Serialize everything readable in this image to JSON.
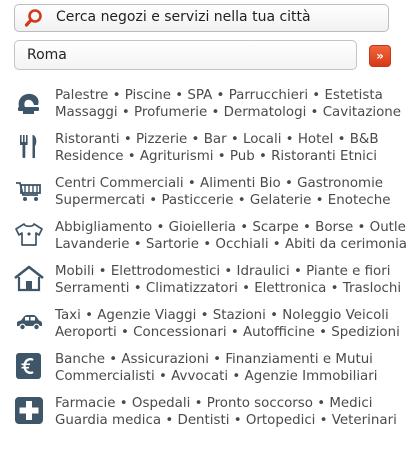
{
  "search": {
    "label": "Cerca negozi e servizi nella tua città"
  },
  "city": {
    "value": "Roma",
    "go_label": "»"
  },
  "categories": [
    {
      "icon": "dryer-icon",
      "line1": "Palestre • Piscine • SPA • Parrucchieri • Estetista",
      "line2": "Massaggi • Profumerie • Dermatologi • Cavitazione"
    },
    {
      "icon": "fork-knife-icon",
      "line1": "Ristoranti • Pizzerie • Bar • Locali • Hotel • B&B",
      "line2": "Residence • Agriturismi • Pub • Ristoranti Etnici"
    },
    {
      "icon": "shopping-cart-icon",
      "line1": "Centri Commerciali • Alimenti Bio • Gastronomie",
      "line2": "Supermercati • Pasticcerie • Gelaterie • Enoteche"
    },
    {
      "icon": "tshirt-icon",
      "line1": "Abbigliamento • Gioielleria • Scarpe • Borse • Outlet",
      "line2": "Lavanderie • Sartorie • Occhiali • Abiti da cerimonia"
    },
    {
      "icon": "house-icon",
      "line1": "Mobili • Elettrodomestici • Idraulici • Piante e fiori",
      "line2": "Serramenti • Climatizzatori • Elettronica • Traslochi"
    },
    {
      "icon": "car-icon",
      "line1": "Taxi • Agenzie Viaggi • Stazioni • Noleggio Veicoli",
      "line2": "Aeroporti • Concessionari • Autofficine • Spedizioni"
    },
    {
      "icon": "euro-icon",
      "line1": "Banche • Assicurazioni • Finanziamenti e Mutui",
      "line2": "Commercialisti • Avvocati • Agenzie Immobiliari"
    },
    {
      "icon": "medical-cross-icon",
      "line1": "Farmacie • Ospedali • Pronto soccorso • Medici",
      "line2": "Guardia medica • Dentisti • Ortopedici • Veterinari"
    }
  ]
}
